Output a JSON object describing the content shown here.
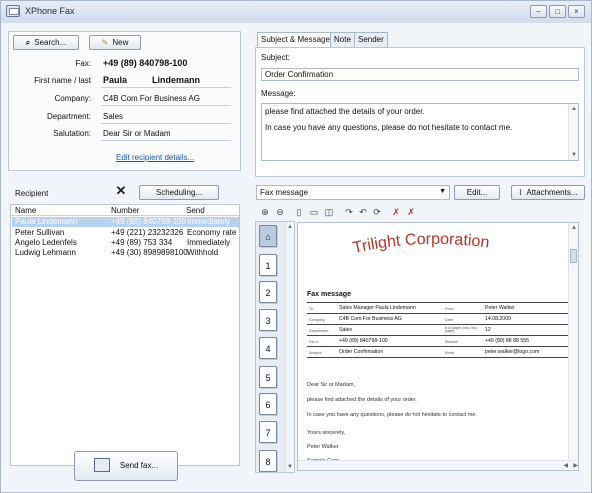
{
  "window": {
    "title": "XPhone Fax"
  },
  "left": {
    "search_label": "Search...",
    "new_label": "New",
    "fields": [
      {
        "label": "Fax:",
        "value": "+49 (89) 840798-100",
        "bold": true
      },
      {
        "label": "First name / last",
        "value": "Paula",
        "value2": "Lindemann",
        "bold": true
      },
      {
        "label": "Company:",
        "value": "C4B Com For Business AG"
      },
      {
        "label": "Department:",
        "value": "Sales"
      },
      {
        "label": "Salutation:",
        "value": "Dear Sir or Madam"
      }
    ],
    "edit_details_link": "Edit recipient details...",
    "recipient_label": "Recipient",
    "scheduling_label": "Scheduling...",
    "columns": [
      "Name",
      "Number",
      "Send"
    ],
    "recipients": [
      {
        "name": "Paula Lindemann",
        "number": "+49 (89) 840798-100",
        "send": "Immediately",
        "selected": true
      },
      {
        "name": "Peter Sullivan",
        "number": "+49 (221) 23232326",
        "send": "Economy rate"
      },
      {
        "name": "Angelo Ledenfels",
        "number": "+49 (89) 753 334",
        "send": "Immediately"
      },
      {
        "name": "Ludwig Lehmann",
        "number": "+49 (30) 8989898100",
        "send": "Withhold"
      }
    ],
    "send_fax_label": "Send fax..."
  },
  "right": {
    "tabs": [
      "Subject & Message",
      "Note",
      "Sender"
    ],
    "subject_label": "Subject:",
    "subject_value": "Order Confirmation",
    "message_label": "Message:",
    "message_lines": [
      "please find attached the details of your order.",
      "In case you have any questions, please do not hesitate to contact me."
    ],
    "template_select": "Fax message",
    "edit_label": "Edit...",
    "attachments_label": "Attachments...",
    "pages": [
      "1",
      "2",
      "3",
      "4",
      "5",
      "6",
      "7",
      "8"
    ],
    "doc": {
      "company": "Trilight Corporation",
      "heading": "Fax message",
      "rows": [
        {
          "l1": "To:",
          "v1": "Sales Manager Paula Lindemann",
          "l2": "From:",
          "v2": "Peter Walker"
        },
        {
          "l1": "Company:",
          "v1": "C4B Com For Business AG",
          "l2": "Date:",
          "v2": "14.08.2009"
        },
        {
          "l1": "Department:",
          "v1": "Sales",
          "l2": "# of pages (incl. this page):",
          "v2": "12"
        },
        {
          "l1": "Fax #:",
          "v1": "+49 (89) 840798-100",
          "l2": "Phone#:",
          "v2": "+49 (89) 88 88 555"
        },
        {
          "l1": "Subject:",
          "v1": "Order Confirmation",
          "l2": "Email:",
          "v2": "peter.walker@logo.com"
        }
      ],
      "body": [
        "Dear Sir or Madam,",
        "please find attached the details of your order.",
        "In case you have any questions, please do not hesitate to contact me.",
        "Yours sincerely,",
        "Peter Walker",
        "Sample Corp."
      ]
    }
  }
}
